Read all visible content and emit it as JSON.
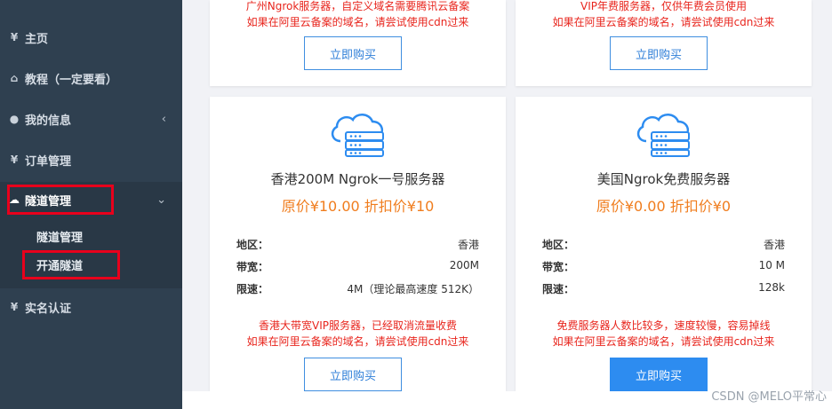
{
  "sidebar": {
    "items": [
      {
        "icon": "yen-icon",
        "glyph": "¥",
        "label": "主页"
      },
      {
        "icon": "home-icon",
        "glyph": "⌂",
        "label": "教程（一定要看）"
      },
      {
        "icon": "user-icon",
        "glyph": "●",
        "label": "我的信息",
        "chevron": "‹"
      },
      {
        "icon": "yen-icon",
        "glyph": "¥",
        "label": "订单管理"
      },
      {
        "icon": "cloud-icon",
        "glyph": "☁",
        "label": "隧道管理",
        "chevron": "⌄"
      },
      {
        "icon": "yen-icon",
        "glyph": "¥",
        "label": "实名认证"
      }
    ],
    "submenu": [
      "隧道管理",
      "开通隧道"
    ]
  },
  "cards_top": [
    {
      "note1": "广州Ngrok服务器，自定义域名需要腾讯云备案",
      "note2": "如果在阿里云备案的域名，请尝试使用cdn过来",
      "button": "立即购买"
    },
    {
      "note1": "VIP年费服务器，仅供年费会员使用",
      "note2": "如果在阿里云备案的域名，请尝试使用cdn过来",
      "button": "立即购买"
    }
  ],
  "cards": [
    {
      "title": "香港200M Ngrok一号服务器",
      "price": "原价¥10.00   折扣价¥10",
      "rows": [
        {
          "k": "地区：",
          "v": "香港"
        },
        {
          "k": "带宽：",
          "v": "200M"
        },
        {
          "k": "限速：",
          "v": "4M（理论最高速度 512K）"
        }
      ],
      "note1": "香港大带宽VIP服务器，已经取消流量收费",
      "note2": "如果在阿里云备案的域名，请尝试使用cdn过来",
      "button": "立即购买"
    },
    {
      "title": "美国Ngrok免费服务器",
      "price": "原价¥0.00   折扣价¥0",
      "rows": [
        {
          "k": "地区：",
          "v": "香港"
        },
        {
          "k": "带宽：",
          "v": "10 M"
        },
        {
          "k": "限速：",
          "v": "128k"
        }
      ],
      "note1": "免费服务器人数比较多，速度较慢，容易掉线",
      "note2": "如果在阿里云备案的域名，请尝试使用cdn过来",
      "button": "立即购买"
    }
  ],
  "watermark": "CSDN @MELO平常心",
  "colors": {
    "sidebar": "#2f4050",
    "accent": "#2d8cf0",
    "price": "#f07d1e",
    "note": "#e8251d",
    "highlight": "#e8001c"
  }
}
